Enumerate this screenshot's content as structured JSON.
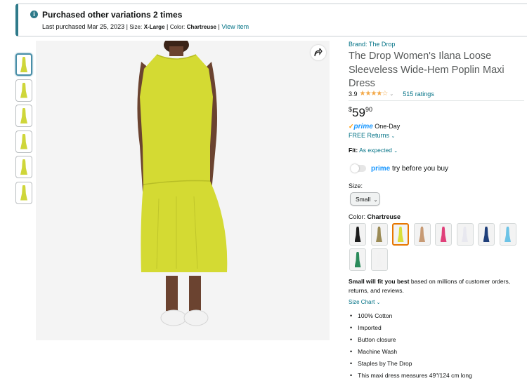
{
  "banner": {
    "title": "Purchased other variations 2 times",
    "last_purchased": "Last purchased Mar 25, 2023",
    "size_label": "Size:",
    "size_value": "X-Large",
    "color_label": "Color:",
    "color_value": "Chartreuse",
    "view_link": "View item",
    "icon": "info-icon"
  },
  "product": {
    "brand": "Brand: The Drop",
    "title": "The Drop Women's Ilana Loose Sleeveless Wide-Hem Poplin Maxi Dress",
    "rating_value": "3.9",
    "rating_stars": 3.9,
    "ratings_count": "515 ratings",
    "price_symbol": "$",
    "price_whole": "59",
    "price_fraction": "90",
    "prime_label": "prime",
    "prime_delivery": "One-Day",
    "returns": "FREE Returns",
    "fit_label": "Fit:",
    "fit_value": "As expected",
    "tbyb_prime": "prime",
    "tbyb_text": "try before you buy",
    "size_label": "Size:",
    "size_selected": "Small",
    "color_label": "Color:",
    "color_selected": "Chartreuse",
    "fit_note_bold": "Small will fit you best",
    "fit_note_rest": "based on millions of customer orders, returns, and reviews.",
    "size_chart": "Size Chart",
    "bullets": [
      "100% Cotton",
      "Imported",
      "Button closure",
      "Machine Wash",
      "Staples by The Drop",
      "This maxi dress measures 49\"/124 cm long"
    ]
  },
  "swatch_colors": [
    "#1c1c1c",
    "#9a8a55",
    "#d9df3a",
    "#c79a74",
    "#e0407a",
    "#e8e8ef",
    "#1f3f7a",
    "#6cc3e6",
    "#2a8a5a",
    "#f2f2f2"
  ],
  "selected_swatch": 2,
  "colors": {
    "accent": "#007185",
    "banner_bar": "#2e7a8a",
    "dress": "#d4da33",
    "prime": "#1a98ff",
    "star": "#f3a847",
    "selected_border": "#e77600"
  }
}
